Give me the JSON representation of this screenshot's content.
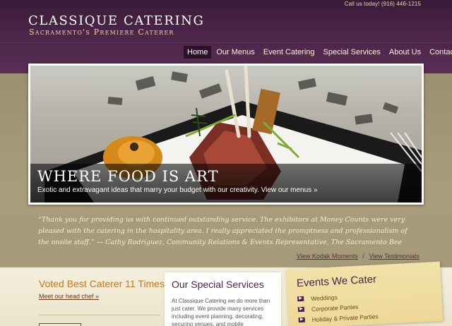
{
  "header": {
    "call_us": "Call us today! (916) 446-1215",
    "logo_title": "CLASSIQUE  CATERING",
    "logo_subtitle": "Sacramento's Premiere Caterer"
  },
  "nav": {
    "items": [
      {
        "label": "Home",
        "active": true
      },
      {
        "label": "Our Menus"
      },
      {
        "label": "Event Catering"
      },
      {
        "label": "Special Services"
      },
      {
        "label": "About Us"
      },
      {
        "label": "Contact"
      }
    ]
  },
  "hero": {
    "title": "WHERE FOOD IS ART",
    "text": "Exotic and extravagant ideas that marry your budget with our creativity.",
    "link": "View our menus »"
  },
  "testimonial": {
    "quote": "“Thank you for providing us with continued outstanding service. The exhibitors at Money Counts were very pleased with the catering in the hospitality area. I really appreciated the promptness and professionalism of the onsite staff.” — Cathy Rodriguez, Community Relations & Events Representative, The Sacramento Bee",
    "link_moments": "View Kodak Moments",
    "separator": "/",
    "link_testimonials": "View Testimonials"
  },
  "award": {
    "title": "Voted Best Caterer 11 Times!",
    "link": "Meet our head chef »"
  },
  "services": {
    "title": "Our Special Services",
    "text": "At Classique Catering we do more than just cater. We provide many services including event planning, decorating, securing venues, and mobile"
  },
  "events": {
    "title": "Events We Cater",
    "items": [
      "Weddings",
      "Corporate Parties",
      "Holiday & Private Parties"
    ]
  },
  "colors": {
    "header_purple": "#4c2548",
    "accent_gold": "#c47a1e",
    "band_tan": "#a89d7b"
  }
}
